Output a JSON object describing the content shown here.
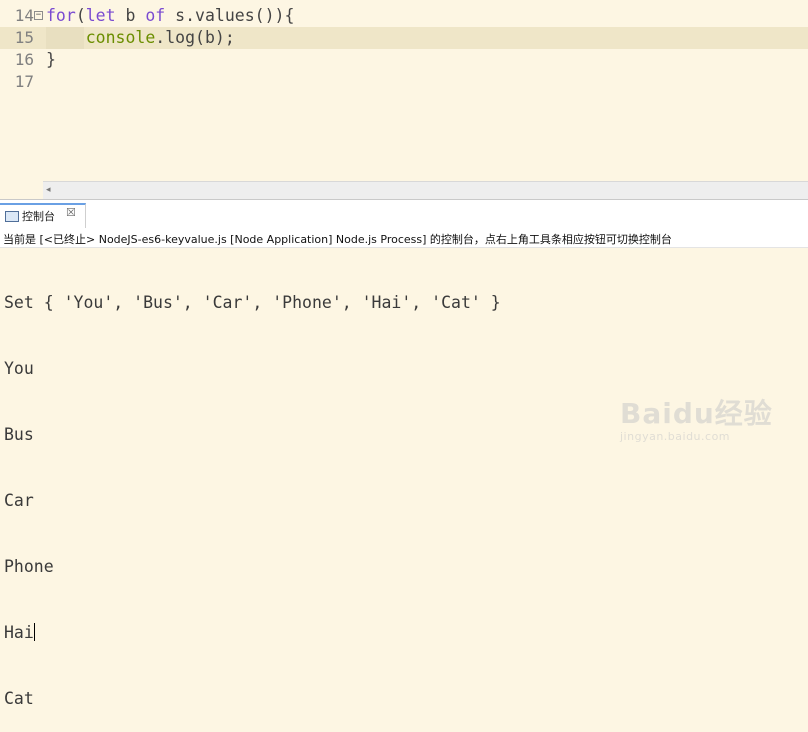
{
  "editor": {
    "lines": [
      {
        "num": "14",
        "text": "for(let b of s.values()){"
      },
      {
        "num": "15",
        "text": "    console.log(b);"
      },
      {
        "num": "16",
        "text": "}"
      },
      {
        "num": "17",
        "text": ""
      }
    ],
    "fold_marker": "−"
  },
  "scrollbar": {
    "left_arrow": "◂"
  },
  "console": {
    "tab_label": "控制台",
    "tab_close": "☒",
    "status": "当前是 [<已终止> NodeJS-es6-keyvalue.js [Node Application] Node.js Process] 的控制台，点右上角工具条相应按钮可切换控制台",
    "output": [
      "Set { 'You', 'Bus', 'Car', 'Phone', 'Hai', 'Cat' }",
      "You",
      "Bus",
      "Car",
      "Phone",
      "Hai",
      "Cat"
    ]
  },
  "watermark": {
    "logo": "Baidu经验",
    "url": "jingyan.baidu.com"
  },
  "colors": {
    "editor_bg": "#fdf6e3",
    "active_line": "#efe6c8",
    "keyword": "#7a4bd1",
    "function": "#6b8e00"
  }
}
